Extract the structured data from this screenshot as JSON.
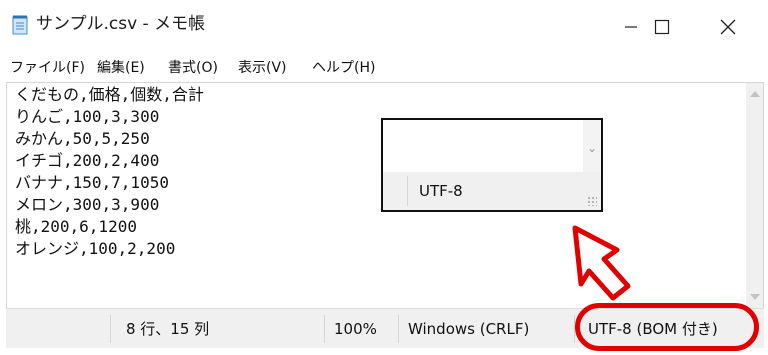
{
  "window": {
    "title": "サンプル.csv - メモ帳",
    "app_icon": "notepad-icon",
    "controls": [
      "minimize-icon",
      "maximize-icon",
      "close-icon"
    ]
  },
  "menu": {
    "items": [
      "ファイル(F)",
      "編集(E)",
      "書式(O)",
      "表示(V)",
      "ヘルプ(H)"
    ]
  },
  "document": {
    "lines": [
      "くだもの,価格,個数,合計",
      "りんご,100,3,300",
      "みかん,50,5,250",
      "イチゴ,200,2,400",
      "バナナ,150,7,1050",
      "メロン,300,3,900",
      "桃,200,6,1200",
      "オレンジ,100,2,200"
    ]
  },
  "inset": {
    "encoding": "UTF-8"
  },
  "status": {
    "position": "8 行、15 列",
    "zoom": "100%",
    "line_ending": "Windows (CRLF)",
    "encoding": "UTF-8 (BOM 付き)"
  },
  "colors": {
    "highlight": "#e00000",
    "statusbar_bg": "#f0f0f0"
  }
}
